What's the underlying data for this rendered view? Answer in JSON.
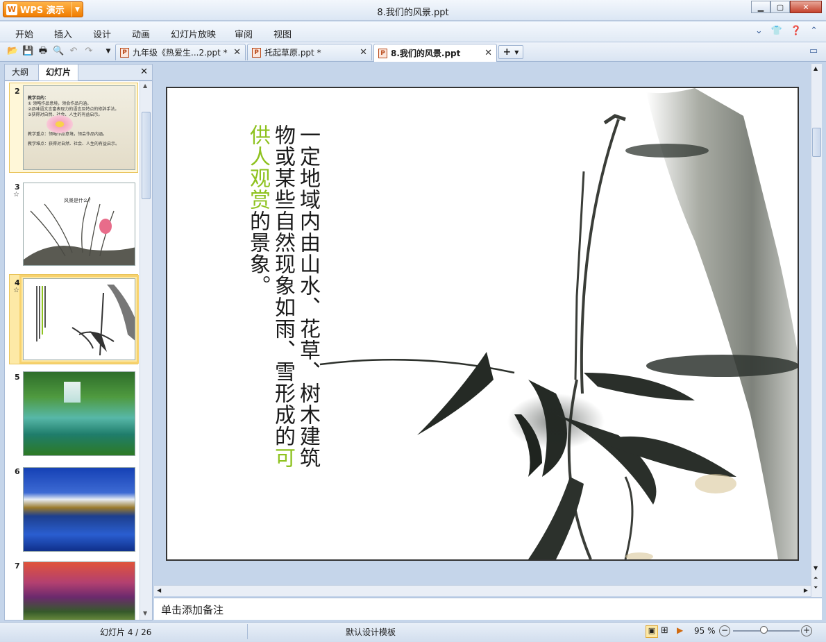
{
  "window": {
    "title": "8.我们的风景.ppt",
    "app_button": "WPS 演示",
    "app_logo": "W"
  },
  "menu": {
    "items": [
      "开始",
      "插入",
      "设计",
      "动画",
      "幻灯片放映",
      "审阅",
      "视图"
    ]
  },
  "tabs": [
    {
      "label": "九年级《热爱生...2.ppt *",
      "active": false
    },
    {
      "label": "托起草原.ppt *",
      "active": false
    },
    {
      "label": "8.我们的风景.ppt",
      "active": true
    }
  ],
  "panel": {
    "tab_outline": "大纲",
    "tab_slides": "幻灯片"
  },
  "thumbs": {
    "s2": {
      "num": "2",
      "l1": "教学目的：",
      "l2": "① 领略作品意境，领会作品内涵。",
      "l3": "②品味语文言富表现力的语言及特点的修辞手法。",
      "l4": "③获得对自然、社会、人生的有益启示。",
      "l5": "教学重点：领略作品意境，领会作品内涵。",
      "l6": "教学难点：获得对自然、社会、人生的有益启示。"
    },
    "s3": {
      "num": "3",
      "star": "☆",
      "title": "风景是什么？"
    },
    "s4": {
      "num": "4",
      "star": "☆"
    },
    "s5": {
      "num": "5"
    },
    "s6": {
      "num": "6"
    },
    "s7": {
      "num": "7"
    }
  },
  "slide": {
    "col1": "一定地域内由山水、花草、树木建筑",
    "col2_black": "物或某些自然现象如雨、雪形成的",
    "col2_green": "可",
    "col3_green": "供人观赏",
    "col3_black": "的景象。"
  },
  "notes": {
    "placeholder": "单击添加备注"
  },
  "status": {
    "slide_info": "幻灯片 4 / 26",
    "template": "默认设计模板",
    "zoom": "95 %"
  },
  "colors": {
    "accent_green": "#8ec21f",
    "wps_orange": "#f07c00",
    "selection": "#fde9a6"
  }
}
